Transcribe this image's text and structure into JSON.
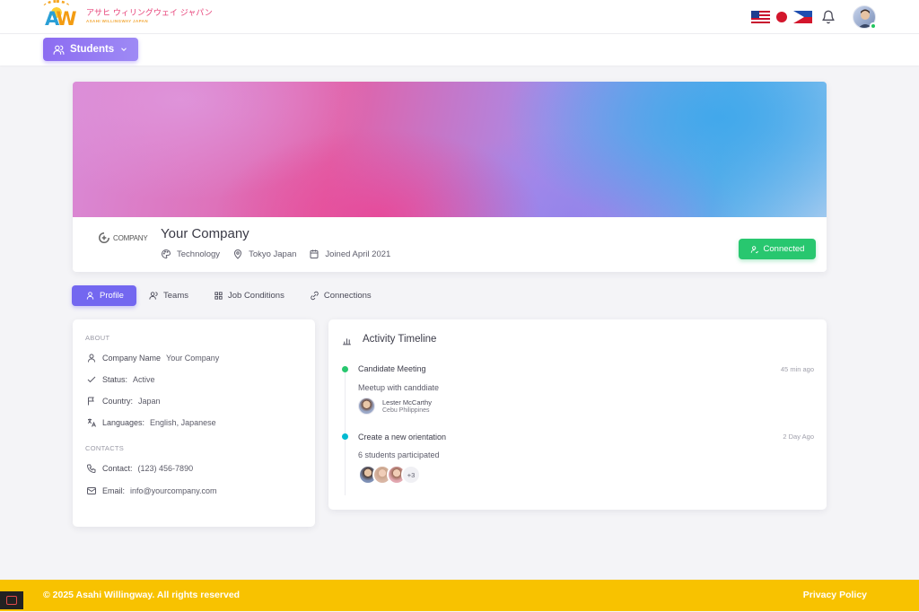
{
  "app": {
    "logo_jp": "アサヒ ウィリングウェイ ジャパン",
    "logo_en": "ASAHI WILLINGWAY JAPAN"
  },
  "header": {
    "nav_button_label": "Students",
    "languages": [
      "us-flag",
      "japan-flag",
      "philippines-flag"
    ]
  },
  "profile": {
    "company_logo_text": "COMPANY",
    "company_name": "Your Company",
    "industry": "Technology",
    "location": "Tokyo Japan",
    "joined": "Joined April 2021",
    "connect_label": "Connected"
  },
  "tabs": [
    {
      "label": "Profile",
      "icon": "user-icon",
      "active": true
    },
    {
      "label": "Teams",
      "icon": "users-icon",
      "active": false
    },
    {
      "label": "Job Conditions",
      "icon": "grid-icon",
      "active": false
    },
    {
      "label": "Connections",
      "icon": "link-icon",
      "active": false
    }
  ],
  "about": {
    "title": "ABOUT",
    "company_name_label": "Company Name",
    "company_name_value": "Your Company",
    "status_label": "Status:",
    "status_value": "Active",
    "country_label": "Country:",
    "country_value": "Japan",
    "languages_label": "Languages:",
    "languages_value": "English, Japanese",
    "contacts_title": "CONTACTS",
    "contact_label": "Contact:",
    "contact_value": "(123) 456-7890",
    "email_label": "Email:",
    "email_value": "info@yourcompany.com"
  },
  "activity": {
    "title": "Activity Timeline",
    "events": [
      {
        "title": "Candidate Meeting",
        "time": "45 min ago",
        "description": "Meetup with canddiate",
        "person_name": "Lester McCarthy",
        "person_location": "Cebu Philippines",
        "dot_color": "#28c76f"
      },
      {
        "title": "Create a new orientation",
        "time": "2 Day Ago",
        "description": "6 students participated",
        "more_count": "+3",
        "dot_color": "#00bad1"
      }
    ]
  },
  "footer": {
    "copyright": "© 2025 Asahi Willingway. All rights reserved",
    "privacy": "Privacy Policy"
  },
  "colors": {
    "primary": "#7367f0",
    "success": "#28c76f",
    "footer": "#f8c200"
  }
}
